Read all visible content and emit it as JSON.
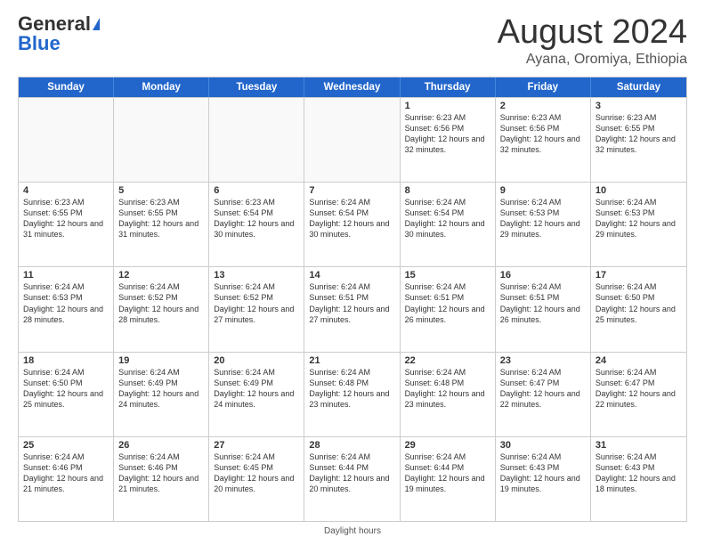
{
  "logo": {
    "general": "General",
    "blue": "Blue"
  },
  "title": {
    "month_year": "August 2024",
    "location": "Ayana, Oromiya, Ethiopia"
  },
  "days_of_week": [
    "Sunday",
    "Monday",
    "Tuesday",
    "Wednesday",
    "Thursday",
    "Friday",
    "Saturday"
  ],
  "footer_text": "Daylight hours",
  "weeks": [
    [
      {
        "day": "",
        "empty": true
      },
      {
        "day": "",
        "empty": true
      },
      {
        "day": "",
        "empty": true
      },
      {
        "day": "",
        "empty": true
      },
      {
        "day": "1",
        "sunrise": "6:23 AM",
        "sunset": "6:56 PM",
        "daylight": "12 hours and 32 minutes."
      },
      {
        "day": "2",
        "sunrise": "6:23 AM",
        "sunset": "6:56 PM",
        "daylight": "12 hours and 32 minutes."
      },
      {
        "day": "3",
        "sunrise": "6:23 AM",
        "sunset": "6:55 PM",
        "daylight": "12 hours and 32 minutes."
      }
    ],
    [
      {
        "day": "4",
        "sunrise": "6:23 AM",
        "sunset": "6:55 PM",
        "daylight": "12 hours and 31 minutes."
      },
      {
        "day": "5",
        "sunrise": "6:23 AM",
        "sunset": "6:55 PM",
        "daylight": "12 hours and 31 minutes."
      },
      {
        "day": "6",
        "sunrise": "6:23 AM",
        "sunset": "6:54 PM",
        "daylight": "12 hours and 30 minutes."
      },
      {
        "day": "7",
        "sunrise": "6:24 AM",
        "sunset": "6:54 PM",
        "daylight": "12 hours and 30 minutes."
      },
      {
        "day": "8",
        "sunrise": "6:24 AM",
        "sunset": "6:54 PM",
        "daylight": "12 hours and 30 minutes."
      },
      {
        "day": "9",
        "sunrise": "6:24 AM",
        "sunset": "6:53 PM",
        "daylight": "12 hours and 29 minutes."
      },
      {
        "day": "10",
        "sunrise": "6:24 AM",
        "sunset": "6:53 PM",
        "daylight": "12 hours and 29 minutes."
      }
    ],
    [
      {
        "day": "11",
        "sunrise": "6:24 AM",
        "sunset": "6:53 PM",
        "daylight": "12 hours and 28 minutes."
      },
      {
        "day": "12",
        "sunrise": "6:24 AM",
        "sunset": "6:52 PM",
        "daylight": "12 hours and 28 minutes."
      },
      {
        "day": "13",
        "sunrise": "6:24 AM",
        "sunset": "6:52 PM",
        "daylight": "12 hours and 27 minutes."
      },
      {
        "day": "14",
        "sunrise": "6:24 AM",
        "sunset": "6:51 PM",
        "daylight": "12 hours and 27 minutes."
      },
      {
        "day": "15",
        "sunrise": "6:24 AM",
        "sunset": "6:51 PM",
        "daylight": "12 hours and 26 minutes."
      },
      {
        "day": "16",
        "sunrise": "6:24 AM",
        "sunset": "6:51 PM",
        "daylight": "12 hours and 26 minutes."
      },
      {
        "day": "17",
        "sunrise": "6:24 AM",
        "sunset": "6:50 PM",
        "daylight": "12 hours and 25 minutes."
      }
    ],
    [
      {
        "day": "18",
        "sunrise": "6:24 AM",
        "sunset": "6:50 PM",
        "daylight": "12 hours and 25 minutes."
      },
      {
        "day": "19",
        "sunrise": "6:24 AM",
        "sunset": "6:49 PM",
        "daylight": "12 hours and 24 minutes."
      },
      {
        "day": "20",
        "sunrise": "6:24 AM",
        "sunset": "6:49 PM",
        "daylight": "12 hours and 24 minutes."
      },
      {
        "day": "21",
        "sunrise": "6:24 AM",
        "sunset": "6:48 PM",
        "daylight": "12 hours and 23 minutes."
      },
      {
        "day": "22",
        "sunrise": "6:24 AM",
        "sunset": "6:48 PM",
        "daylight": "12 hours and 23 minutes."
      },
      {
        "day": "23",
        "sunrise": "6:24 AM",
        "sunset": "6:47 PM",
        "daylight": "12 hours and 22 minutes."
      },
      {
        "day": "24",
        "sunrise": "6:24 AM",
        "sunset": "6:47 PM",
        "daylight": "12 hours and 22 minutes."
      }
    ],
    [
      {
        "day": "25",
        "sunrise": "6:24 AM",
        "sunset": "6:46 PM",
        "daylight": "12 hours and 21 minutes."
      },
      {
        "day": "26",
        "sunrise": "6:24 AM",
        "sunset": "6:46 PM",
        "daylight": "12 hours and 21 minutes."
      },
      {
        "day": "27",
        "sunrise": "6:24 AM",
        "sunset": "6:45 PM",
        "daylight": "12 hours and 20 minutes."
      },
      {
        "day": "28",
        "sunrise": "6:24 AM",
        "sunset": "6:44 PM",
        "daylight": "12 hours and 20 minutes."
      },
      {
        "day": "29",
        "sunrise": "6:24 AM",
        "sunset": "6:44 PM",
        "daylight": "12 hours and 19 minutes."
      },
      {
        "day": "30",
        "sunrise": "6:24 AM",
        "sunset": "6:43 PM",
        "daylight": "12 hours and 19 minutes."
      },
      {
        "day": "31",
        "sunrise": "6:24 AM",
        "sunset": "6:43 PM",
        "daylight": "12 hours and 18 minutes."
      }
    ]
  ]
}
